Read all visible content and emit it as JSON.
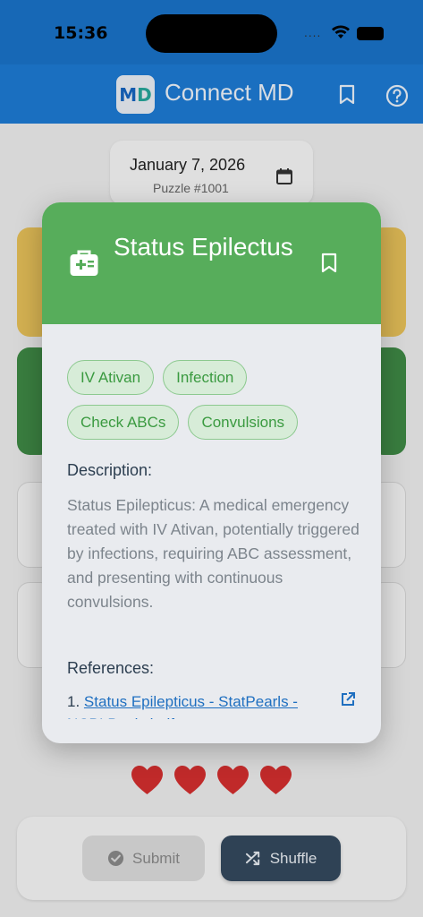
{
  "status_bar": {
    "time": "15:36",
    "signal_dots": "...."
  },
  "app_bar": {
    "logo_text_m": "M",
    "logo_text_d": "D",
    "title": "Connect MD"
  },
  "date_card": {
    "date": "January 7, 2026",
    "puzzle": "Puzzle #1001"
  },
  "modal": {
    "title": "Status Epilectus",
    "chips": [
      "IV Ativan",
      "Infection",
      "Check ABCs",
      "Convulsions"
    ],
    "description_label": "Description:",
    "description": "Status Epilepticus: A medical emergency treated with IV Ativan, potentially triggered by infections, requiring ABC assessment, and presenting with continuous convulsions.",
    "references_label": "References:",
    "references": [
      {
        "number": "1.",
        "text": "Status Epilepticus - StatPearls - NCBI Bookshelf"
      }
    ]
  },
  "lives": {
    "remaining": 4,
    "color": "#d32f2f"
  },
  "actions": {
    "submit_label": "Submit",
    "shuffle_label": "Shuffle"
  },
  "colors": {
    "app_bar": "#1d7ad3",
    "modal_header": "#57ad5b",
    "chip_text": "#3a9a40",
    "shuffle_button": "#34495e"
  }
}
